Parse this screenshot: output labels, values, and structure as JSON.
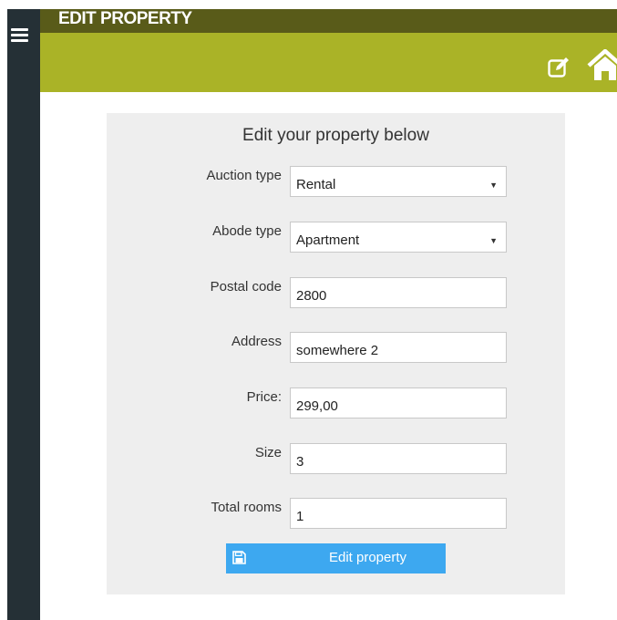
{
  "header": {
    "title": "EDIT PROPERTY",
    "menu_icon": "hamburger-menu-icon",
    "edit_icon": "edit-icon",
    "home_icon": "home-icon"
  },
  "colors": {
    "sidebar": "#253036",
    "topbar": "#595b19",
    "subbar": "#aab327",
    "panel": "#eeeeee",
    "button": "#3da8f0"
  },
  "form": {
    "heading": "Edit your property below",
    "fields": [
      {
        "label": "Auction type",
        "value": "Rental",
        "type": "select"
      },
      {
        "label": "Abode type",
        "value": "Apartment",
        "type": "select"
      },
      {
        "label": "Postal code",
        "value": "2800",
        "type": "text"
      },
      {
        "label": "Address",
        "value": "somewhere 2",
        "type": "text"
      },
      {
        "label": "Price:",
        "value": "299,00",
        "type": "text"
      },
      {
        "label": "Size",
        "value": "3",
        "type": "text"
      },
      {
        "label": "Total rooms",
        "value": "1",
        "type": "text"
      }
    ],
    "submit_label": "Edit property",
    "submit_icon": "save-icon"
  }
}
